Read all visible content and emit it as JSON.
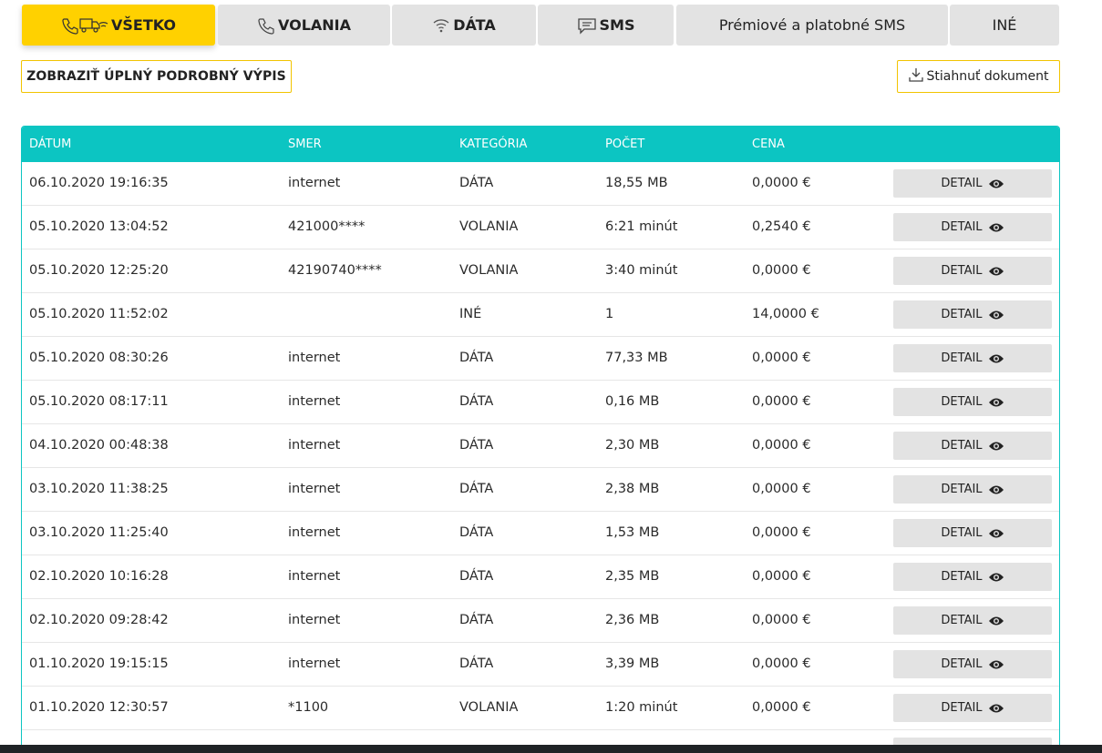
{
  "tabs": [
    {
      "label": "VŠETKO",
      "icon": "all-types-icon",
      "active": true
    },
    {
      "label": "VOLANIA",
      "icon": "phone-icon",
      "active": false
    },
    {
      "label": "DÁTA",
      "icon": "wifi-icon",
      "active": false
    },
    {
      "label": "SMS",
      "icon": "message-icon",
      "active": false
    },
    {
      "label": "Prémiové a platobné SMS",
      "icon": "",
      "active": false
    },
    {
      "label": "INÉ",
      "icon": "",
      "active": false
    }
  ],
  "actions": {
    "full_statement_label": "ZOBRAZIŤ ÚPLNÝ PODROBNÝ VÝPIS",
    "download_label": "Stiahnuť dokument",
    "download_icon": "download-icon"
  },
  "table": {
    "headers": [
      "DÁTUM",
      "SMER",
      "KATEGÓRIA",
      "POČET",
      "CENA"
    ],
    "detail_label": "DETAIL",
    "detail_icon": "eye-icon",
    "rows": [
      [
        "06.10.2020 19:16:35",
        "internet",
        "DÁTA",
        "18,55 MB",
        "0,0000 €"
      ],
      [
        "05.10.2020 13:04:52",
        "421000****",
        "VOLANIA",
        "6:21 minút",
        "0,2540 €"
      ],
      [
        "05.10.2020 12:25:20",
        "42190740****",
        "VOLANIA",
        "3:40 minút",
        "0,0000 €"
      ],
      [
        "05.10.2020 11:52:02",
        "",
        "INÉ",
        "1",
        "14,0000 €"
      ],
      [
        "05.10.2020 08:30:26",
        "internet",
        "DÁTA",
        "77,33 MB",
        "0,0000 €"
      ],
      [
        "05.10.2020 08:17:11",
        "internet",
        "DÁTA",
        "0,16 MB",
        "0,0000 €"
      ],
      [
        "04.10.2020 00:48:38",
        "internet",
        "DÁTA",
        "2,30 MB",
        "0,0000 €"
      ],
      [
        "03.10.2020 11:38:25",
        "internet",
        "DÁTA",
        "2,38 MB",
        "0,0000 €"
      ],
      [
        "03.10.2020 11:25:40",
        "internet",
        "DÁTA",
        "1,53 MB",
        "0,0000 €"
      ],
      [
        "02.10.2020 10:16:28",
        "internet",
        "DÁTA",
        "2,35 MB",
        "0,0000 €"
      ],
      [
        "02.10.2020 09:28:42",
        "internet",
        "DÁTA",
        "2,36 MB",
        "0,0000 €"
      ],
      [
        "01.10.2020 19:15:15",
        "internet",
        "DÁTA",
        "3,39 MB",
        "0,0000 €"
      ],
      [
        "01.10.2020 12:30:57",
        "*1100",
        "VOLANIA",
        "1:20 minút",
        "0,0000 €"
      ]
    ]
  },
  "colors": {
    "accent_yellow": "#ffd100",
    "header_teal": "#0cc5c2",
    "tab_gray": "#e3e3e3"
  }
}
